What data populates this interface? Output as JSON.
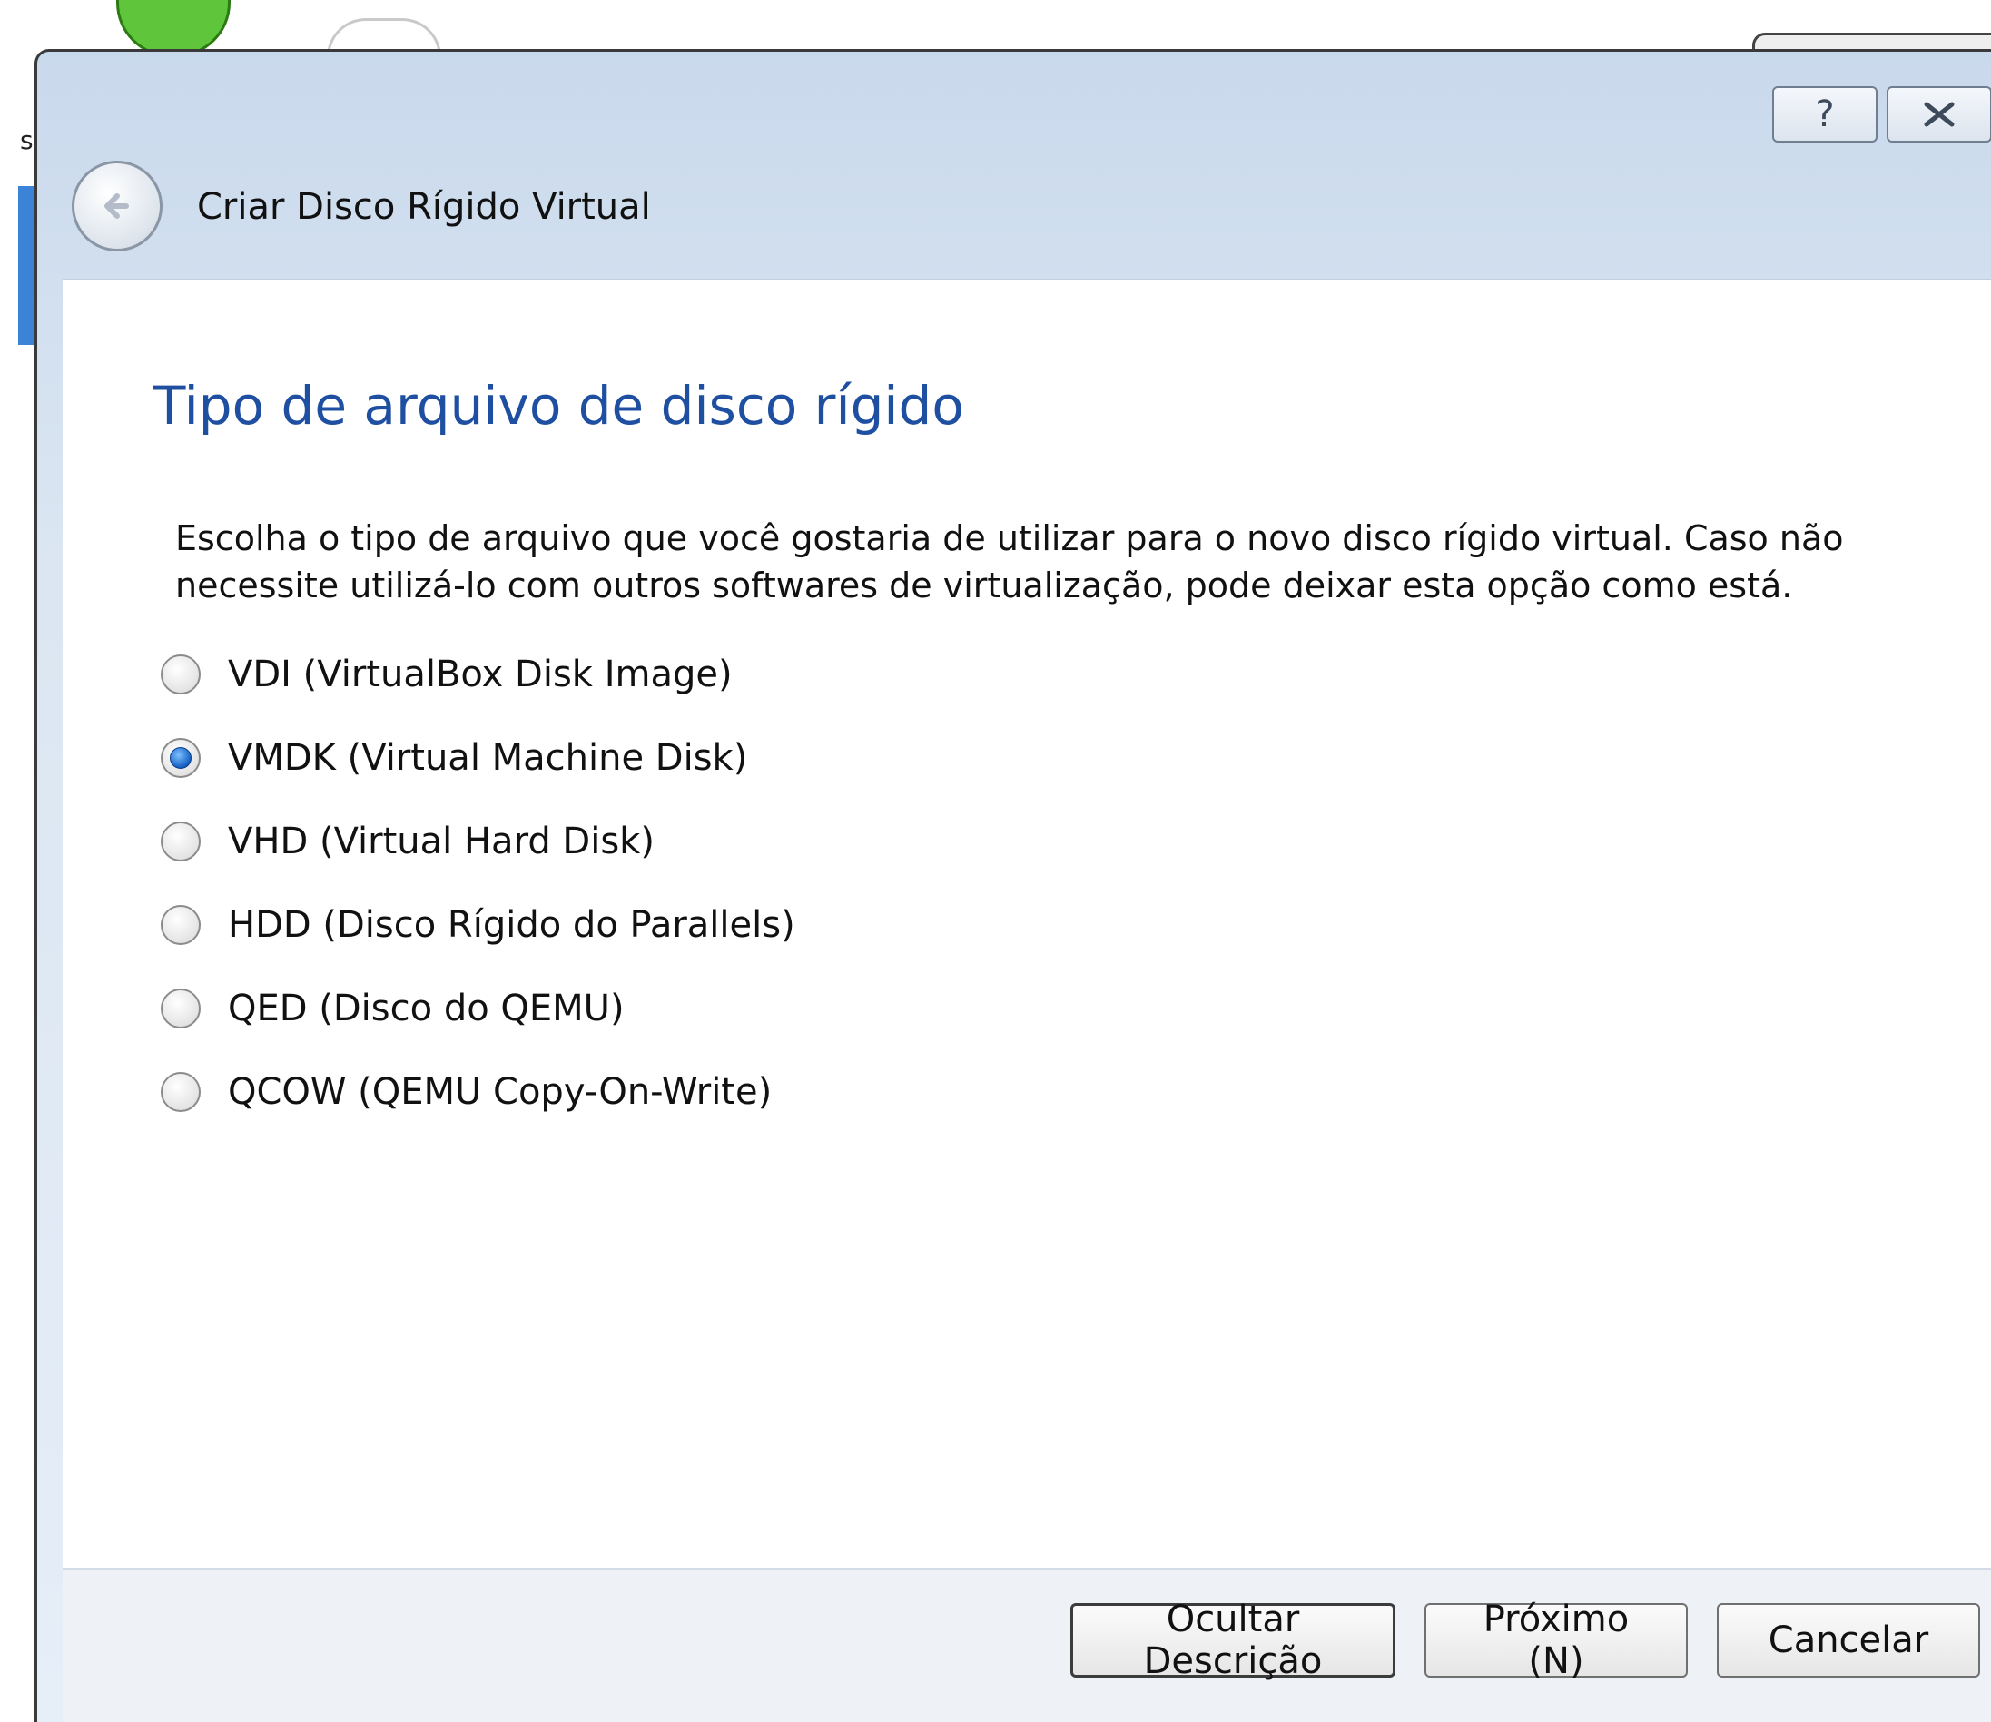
{
  "background": {
    "partial_letter": "s"
  },
  "dialog": {
    "title": "Criar Disco Rígido Virtual",
    "help_icon": "?",
    "close_icon": "X"
  },
  "page": {
    "heading": "Tipo de arquivo de disco rígido",
    "description": "Escolha o tipo de arquivo que você gostaria de utilizar para o novo disco rígido virtual. Caso não necessite utilizá-lo com outros softwares de virtualização, pode deixar esta opção como está.",
    "options": [
      {
        "label": "VDI (VirtualBox Disk Image)",
        "checked": false
      },
      {
        "label": "VMDK (Virtual Machine Disk)",
        "checked": true
      },
      {
        "label": "VHD (Virtual Hard Disk)",
        "checked": false
      },
      {
        "label": "HDD (Disco Rígido do Parallels)",
        "checked": false
      },
      {
        "label": "QED (Disco do QEMU)",
        "checked": false
      },
      {
        "label": "QCOW (QEMU Copy-On-Write)",
        "checked": false
      }
    ]
  },
  "footer": {
    "hide_description_label": "Ocultar Descrição",
    "next_label": "Próximo (N)",
    "cancel_label": "Cancelar"
  },
  "colors": {
    "heading": "#1f4fa0",
    "radio_selected": "#1561c4",
    "title_bar": "#c9d9ec"
  }
}
